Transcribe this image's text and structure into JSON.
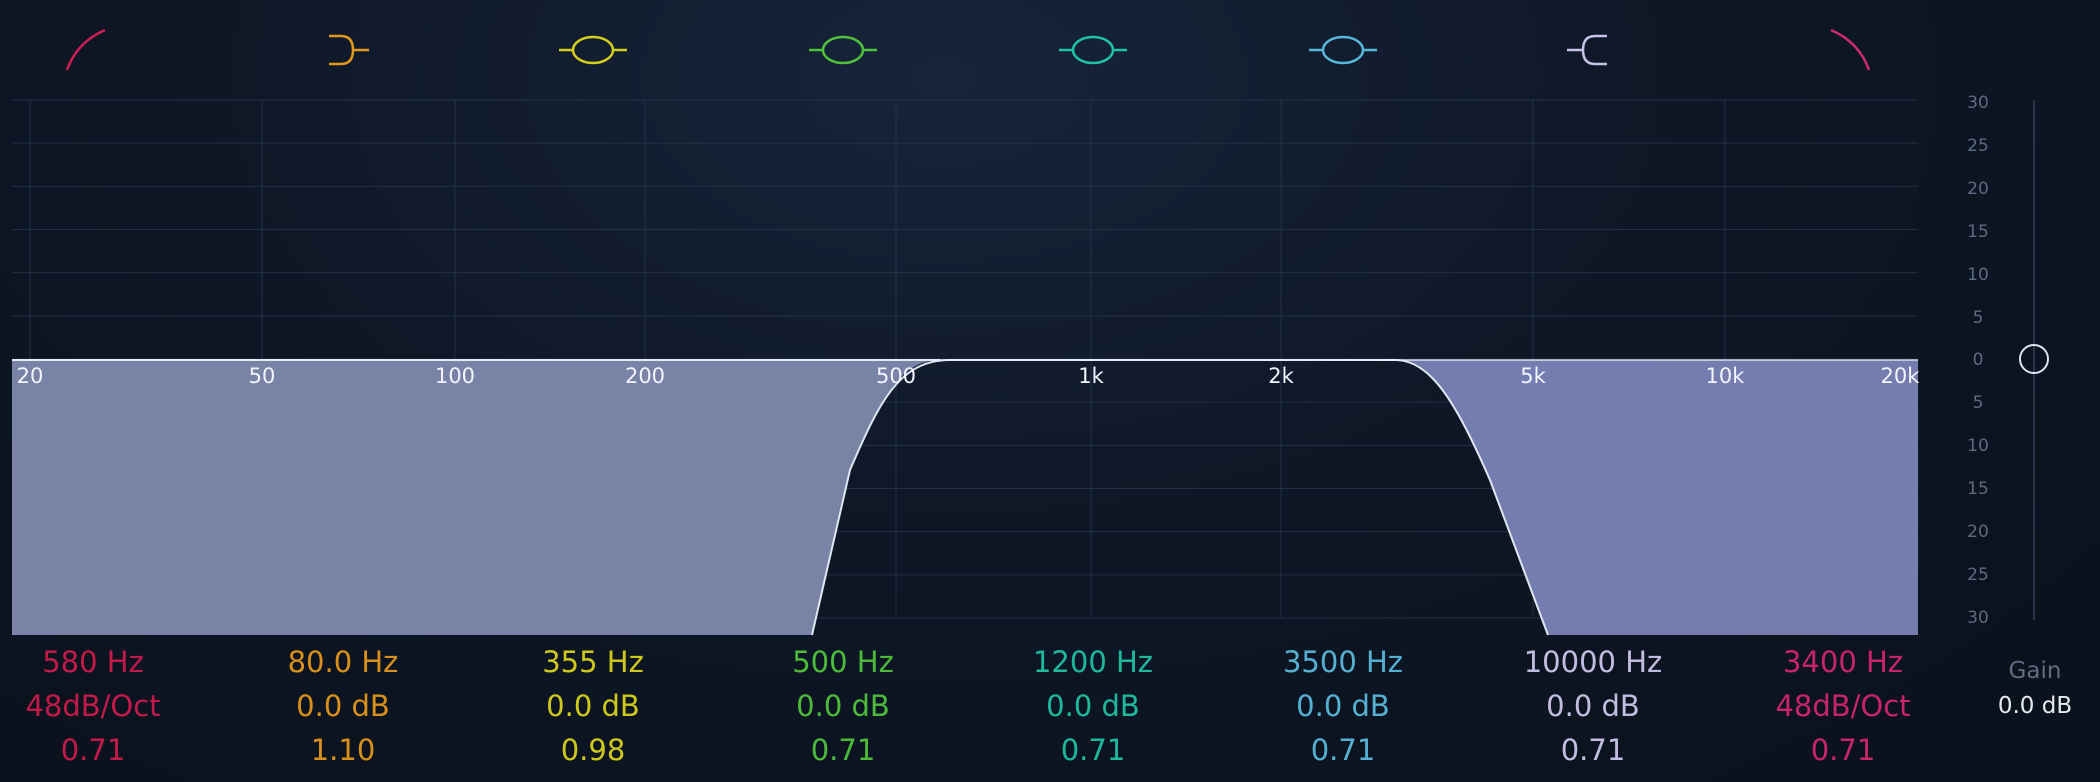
{
  "bands": [
    {
      "icon": "high-pass-filter-icon",
      "color": "#d01f55",
      "freq": "580 Hz",
      "gain": "48dB/Oct",
      "q": "0.71"
    },
    {
      "icon": "low-shelf-icon",
      "color": "#e39a1b",
      "freq": "80.0 Hz",
      "gain": "0.0 dB",
      "q": "1.10"
    },
    {
      "icon": "bell-icon",
      "color": "#d5cf1c",
      "freq": "355 Hz",
      "gain": "0.0 dB",
      "q": "0.98"
    },
    {
      "icon": "bell-icon",
      "color": "#4fc23b",
      "freq": "500 Hz",
      "gain": "0.0 dB",
      "q": "0.71"
    },
    {
      "icon": "bell-icon",
      "color": "#1fc3a5",
      "freq": "1200 Hz",
      "gain": "0.0 dB",
      "q": "0.71"
    },
    {
      "icon": "bell-icon",
      "color": "#57b7d8",
      "freq": "3500 Hz",
      "gain": "0.0 dB",
      "q": "0.71"
    },
    {
      "icon": "high-shelf-icon",
      "color": "#c8c3e6",
      "freq": "10000 Hz",
      "gain": "0.0 dB",
      "q": "0.71"
    },
    {
      "icon": "low-pass-filter-icon",
      "color": "#cf2a72",
      "freq": "3400 Hz",
      "gain": "48dB/Oct",
      "q": "0.71"
    }
  ],
  "freq_labels": [
    "20",
    "50",
    "100",
    "200",
    "500",
    "1k",
    "2k",
    "5k",
    "10k",
    "20k"
  ],
  "db_labels": [
    "30",
    "25",
    "20",
    "15",
    "10",
    "5",
    "0",
    "5",
    "10",
    "15",
    "20",
    "25",
    "30"
  ],
  "gain": {
    "label": "Gain",
    "value": "0.0 dB"
  },
  "colors": {
    "fill": "#8089ad",
    "grid": "#2a3a52",
    "curve": "#dfe6f2"
  }
}
